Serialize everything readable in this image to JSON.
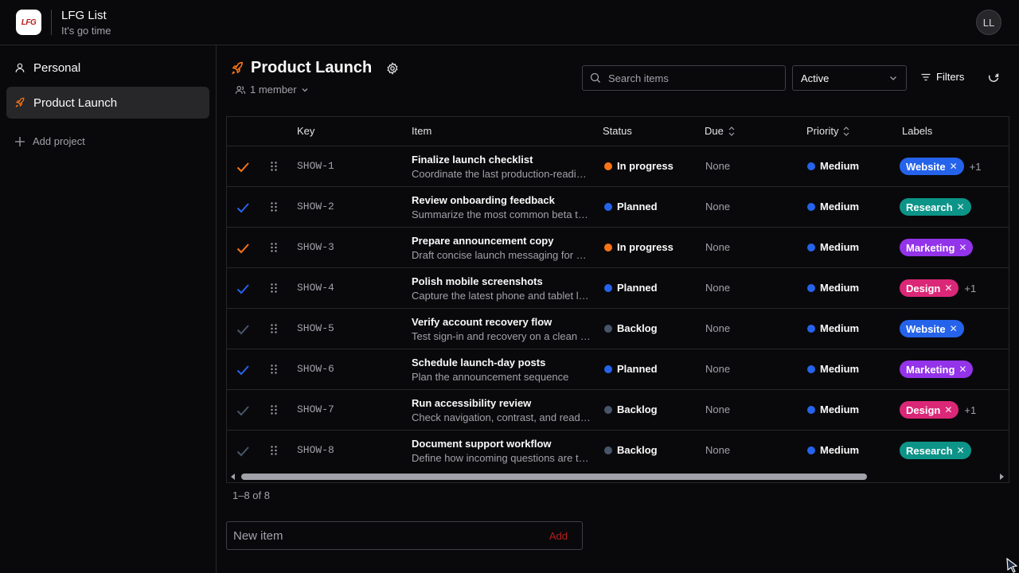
{
  "app": {
    "title": "LFG List",
    "subtitle": "It's go time",
    "logo_text": "LFG",
    "avatar_initials": "LL"
  },
  "sidebar": {
    "items": [
      {
        "label": "Personal",
        "icon": "user-icon",
        "active": false
      },
      {
        "label": "Product Launch",
        "icon": "rocket-icon",
        "active": true
      }
    ],
    "add_project": "Add project"
  },
  "project": {
    "name": "Product Launch",
    "members": "1 member"
  },
  "toolbar": {
    "search_placeholder": "Search items",
    "status_filter": "Active",
    "filters_label": "Filters"
  },
  "table": {
    "headers": {
      "key": "Key",
      "item": "Item",
      "status": "Status",
      "due": "Due",
      "priority": "Priority",
      "labels": "Labels"
    },
    "rows": [
      {
        "key": "SHOW-1",
        "title": "Finalize launch checklist",
        "desc": "Coordinate the last production-readiness checks",
        "status": "In progress",
        "due": "None",
        "priority": "Medium",
        "label": "Website",
        "more": "+1",
        "check_color": "#f97316"
      },
      {
        "key": "SHOW-2",
        "title": "Review onboarding feedback",
        "desc": "Summarize the most common beta tester notes",
        "status": "Planned",
        "due": "None",
        "priority": "Medium",
        "label": "Research",
        "more": "",
        "check_color": "#2563eb"
      },
      {
        "key": "SHOW-3",
        "title": "Prepare announcement copy",
        "desc": "Draft concise launch messaging for email",
        "status": "In progress",
        "due": "None",
        "priority": "Medium",
        "label": "Marketing",
        "more": "",
        "check_color": "#f97316"
      },
      {
        "key": "SHOW-4",
        "title": "Polish mobile screenshots",
        "desc": "Capture the latest phone and tablet layouts",
        "status": "Planned",
        "due": "None",
        "priority": "Medium",
        "label": "Design",
        "more": "+1",
        "check_color": "#2563eb"
      },
      {
        "key": "SHOW-5",
        "title": "Verify account recovery flow",
        "desc": "Test sign-in and recovery on a clean device",
        "status": "Backlog",
        "due": "None",
        "priority": "Medium",
        "label": "Website",
        "more": "",
        "check_color": "#475569"
      },
      {
        "key": "SHOW-6",
        "title": "Schedule launch-day posts",
        "desc": "Plan the announcement sequence",
        "status": "Planned",
        "due": "None",
        "priority": "Medium",
        "label": "Marketing",
        "more": "",
        "check_color": "#2563eb"
      },
      {
        "key": "SHOW-7",
        "title": "Run accessibility review",
        "desc": "Check navigation, contrast, and readability",
        "status": "Backlog",
        "due": "None",
        "priority": "Medium",
        "label": "Design",
        "more": "+1",
        "check_color": "#475569"
      },
      {
        "key": "SHOW-8",
        "title": "Document support workflow",
        "desc": "Define how incoming questions are triaged",
        "status": "Backlog",
        "due": "None",
        "priority": "Medium",
        "label": "Research",
        "more": "",
        "check_color": "#475569"
      }
    ]
  },
  "pagination": "1–8 of 8",
  "new_item": {
    "placeholder": "New item",
    "add_label": "Add"
  },
  "colors": {
    "in_progress": "#f97316",
    "planned": "#2563eb",
    "backlog": "#475569",
    "medium": "#2563eb",
    "Website": "#2563eb",
    "Research": "#0d9488",
    "Marketing": "#9333ea",
    "Design": "#db2777"
  }
}
